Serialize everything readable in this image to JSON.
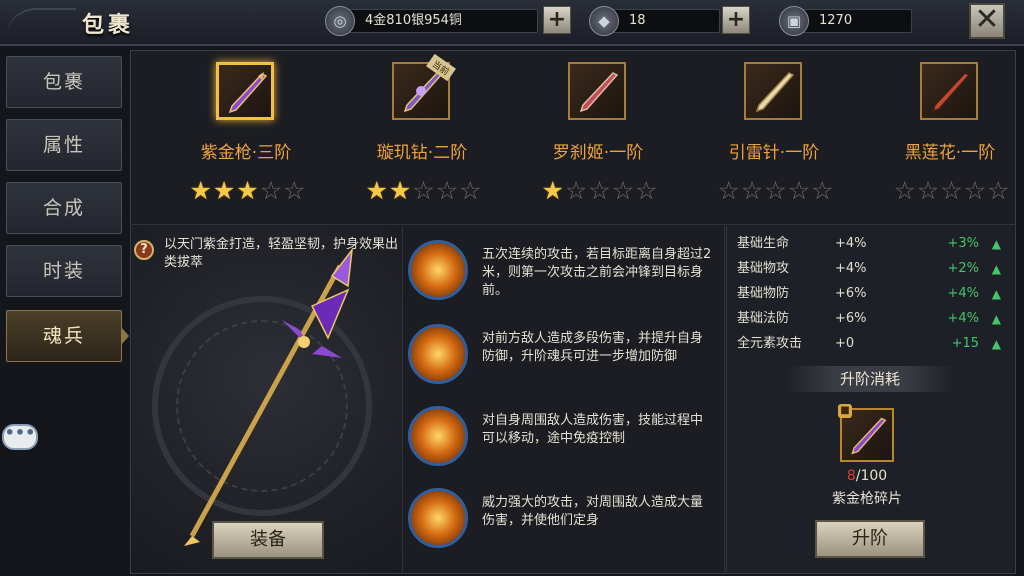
{
  "header": {
    "title": "包裹",
    "currency": {
      "money": "4金810银954铜",
      "diamonds": "18",
      "tokens": "1270"
    },
    "close_symbol": "✕",
    "plus_symbol": "+"
  },
  "nav": {
    "tabs": [
      {
        "label": "包裹",
        "active": false
      },
      {
        "label": "属性",
        "active": false
      },
      {
        "label": "合成",
        "active": false
      },
      {
        "label": "时装",
        "active": false
      },
      {
        "label": "魂兵",
        "active": true
      }
    ]
  },
  "weapons": [
    {
      "name": "紫金枪·三阶",
      "stars": 3,
      "max_stars": 5,
      "selected": true,
      "equipped": false,
      "color": "#8a4ad0"
    },
    {
      "name": "璇玑钻·二阶",
      "stars": 2,
      "max_stars": 5,
      "selected": false,
      "equipped": true,
      "badge": "当前",
      "color": "#7b5ac8"
    },
    {
      "name": "罗刹姬·一阶",
      "stars": 1,
      "max_stars": 5,
      "selected": false,
      "equipped": false,
      "color": "#c84a5a"
    },
    {
      "name": "引雷针·一阶",
      "stars": 0,
      "max_stars": 5,
      "selected": false,
      "equipped": false,
      "color": "#e8d8b0"
    },
    {
      "name": "黑莲花·一阶",
      "stars": 0,
      "max_stars": 5,
      "selected": false,
      "equipped": false,
      "color": "#c8482a"
    }
  ],
  "detail": {
    "description": "以天门紫金打造，轻盈坚韧，护身效果出类拔萃",
    "help_symbol": "?",
    "equip_label": "装备"
  },
  "skills": [
    {
      "text": "五次连续的攻击，若目标距离自身超过2米，则第一次攻击之前会冲锋到目标身前。"
    },
    {
      "text": "对前方敌人造成多段伤害，并提升自身防御，升阶魂兵可进一步增加防御"
    },
    {
      "text": "对自身周围敌人造成伤害，技能过程中可以移动，途中免疫控制"
    },
    {
      "text": "威力强大的攻击，对周围敌人造成大量伤害，并使他们定身"
    }
  ],
  "stats": [
    {
      "name": "基础生命",
      "base": "+4%",
      "increase": "+3%"
    },
    {
      "name": "基础物攻",
      "base": "+4%",
      "increase": "+2%"
    },
    {
      "name": "基础物防",
      "base": "+6%",
      "increase": "+4%"
    },
    {
      "name": "基础法防",
      "base": "+6%",
      "increase": "+4%"
    },
    {
      "name": "全元素攻击",
      "base": "+0",
      "increase": "+15"
    }
  ],
  "upgrade": {
    "cost_title": "升阶消耗",
    "material_name": "紫金枪碎片",
    "have": "8",
    "need": "/100",
    "button_label": "升阶"
  },
  "chat_symbol": "•••",
  "colors": {
    "accent_gold": "#f0a23a",
    "stat_green": "#45c46a",
    "insufficient_red": "#e23a2a"
  }
}
